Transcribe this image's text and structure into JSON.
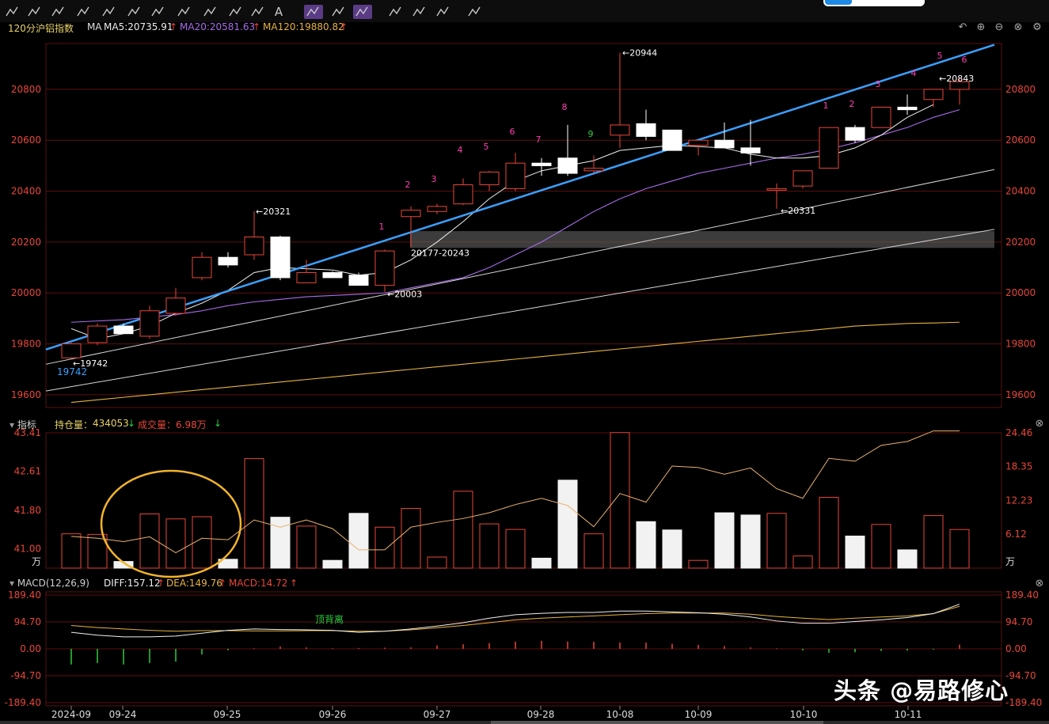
{
  "toolbar": {
    "icons": [
      "trend-line-icon",
      "polyline-icon",
      "segment-icon",
      "ray-icon",
      "price-line-icon",
      "channel-icon",
      "parallel-line-icon",
      "range-icon",
      "fib-icon",
      "fan-icon",
      "gann-icon",
      "text-icon",
      "more-icon",
      "magnet-icon",
      "layers-icon",
      "pen-icon",
      "eye-icon",
      "trash-icon",
      "grid-icon",
      "ruler-icon"
    ],
    "text_tool_label": "A",
    "more_label": "⋯"
  },
  "header": {
    "period": "120分",
    "symbol": "沪铝指数",
    "ma_label": "MA",
    "ma5": "MA5:20735.91",
    "ma20": "MA20:20581.63",
    "ma120": "MA120:19880.82",
    "arrow_up": "↑"
  },
  "colors": {
    "up": "#e8463a",
    "down": "#ffffff",
    "ma5": "#f0f0f0",
    "ma20": "#a66de8",
    "ma120": "#e6b340",
    "trend": "#3aa0ff",
    "grid": "#5c1010",
    "axis_text": "#e8463a",
    "td_count": "#ff3fb0",
    "td_count_green": "#2ecc40"
  },
  "price_axis": {
    "left_labels": [
      "20800",
      "20600",
      "20400",
      "20200",
      "20000",
      "19800",
      "19600"
    ],
    "right_labels": [
      "20800",
      "20600",
      "20400",
      "20200",
      "20000",
      "19800",
      "19600"
    ]
  },
  "annotations": {
    "high_20944": "←20944",
    "high_20843": "←20843",
    "high_20321": "←20321",
    "low_20331": "←20331",
    "low_20003": "←20003",
    "low_19742": "←19742",
    "trend_start": "19742",
    "band_label": "20177-20243"
  },
  "td_counts": [
    "1",
    "2",
    "3",
    "4",
    "5",
    "6",
    "7",
    "8",
    "9",
    "1",
    "2",
    "3",
    "4",
    "5",
    "6"
  ],
  "volume_section": {
    "title": "指标",
    "oi_label": "持仓量：",
    "oi_value": "434053",
    "vol_label": "成交量：",
    "vol_value": "6.98万",
    "down_arrow": "↓",
    "left_labels": [
      "43.41",
      "42.61",
      "41.80",
      "41.00",
      "万"
    ],
    "right_labels": [
      "24.46",
      "18.35",
      "12.23",
      "6.12",
      "万"
    ]
  },
  "macd_section": {
    "title": "MACD(12,26,9)",
    "diff": "DIFF:157.12",
    "dea": "DEA:149.76",
    "macd": "MACD:14.72",
    "arrow_up": "↑",
    "left_labels": [
      "189.40",
      "94.70",
      "0.00",
      "-94.70",
      "-189.40"
    ],
    "right_labels": [
      "189.40",
      "94.70",
      "0.00",
      "-94.70",
      "-189.40"
    ],
    "divergence_label": "顶背离"
  },
  "time_axis": [
    "2024-09",
    "09-24",
    "09-25",
    "09-26",
    "09-27",
    "09-28",
    "10-08",
    "10-09",
    "10-10",
    "10-11"
  ],
  "watermark": "头条 @易路修心",
  "chart_data": {
    "type": "candlestick",
    "candles": [
      {
        "o": 19745,
        "h": 19805,
        "l": 19742,
        "c": 19800
      },
      {
        "o": 19805,
        "h": 19880,
        "l": 19795,
        "c": 19870
      },
      {
        "o": 19870,
        "h": 19880,
        "l": 19840,
        "c": 19840
      },
      {
        "o": 19830,
        "h": 19950,
        "l": 19820,
        "c": 19930
      },
      {
        "o": 19920,
        "h": 20020,
        "l": 19910,
        "c": 19980
      },
      {
        "o": 20060,
        "h": 20160,
        "l": 20050,
        "c": 20140
      },
      {
        "o": 20140,
        "h": 20160,
        "l": 20100,
        "c": 20110
      },
      {
        "o": 20150,
        "h": 20321,
        "l": 20130,
        "c": 20220
      },
      {
        "o": 20220,
        "h": 20225,
        "l": 20050,
        "c": 20060
      },
      {
        "o": 20040,
        "h": 20130,
        "l": 20040,
        "c": 20080
      },
      {
        "o": 20080,
        "h": 20085,
        "l": 20060,
        "c": 20060
      },
      {
        "o": 20070,
        "h": 20080,
        "l": 20030,
        "c": 20030
      },
      {
        "o": 20030,
        "h": 20170,
        "l": 20003,
        "c": 20165
      },
      {
        "o": 20300,
        "h": 20340,
        "l": 20180,
        "c": 20325
      },
      {
        "o": 20320,
        "h": 20350,
        "l": 20310,
        "c": 20340
      },
      {
        "o": 20350,
        "h": 20450,
        "l": 20345,
        "c": 20425
      },
      {
        "o": 20425,
        "h": 20480,
        "l": 20400,
        "c": 20475
      },
      {
        "o": 20410,
        "h": 20550,
        "l": 20400,
        "c": 20510
      },
      {
        "o": 20510,
        "h": 20530,
        "l": 20460,
        "c": 20500
      },
      {
        "o": 20530,
        "h": 20660,
        "l": 20460,
        "c": 20470
      },
      {
        "o": 20480,
        "h": 20540,
        "l": 20470,
        "c": 20490
      },
      {
        "o": 20620,
        "h": 20944,
        "l": 20570,
        "c": 20660
      },
      {
        "o": 20665,
        "h": 20720,
        "l": 20600,
        "c": 20615
      },
      {
        "o": 20640,
        "h": 20640,
        "l": 20560,
        "c": 20560
      },
      {
        "o": 20580,
        "h": 20600,
        "l": 20540,
        "c": 20600
      },
      {
        "o": 20600,
        "h": 20670,
        "l": 20570,
        "c": 20570
      },
      {
        "o": 20570,
        "h": 20680,
        "l": 20500,
        "c": 20550
      },
      {
        "o": 20410,
        "h": 20430,
        "l": 20331,
        "c": 20410
      },
      {
        "o": 20420,
        "h": 20480,
        "l": 20410,
        "c": 20480
      },
      {
        "o": 20490,
        "h": 20650,
        "l": 20490,
        "c": 20650
      },
      {
        "o": 20650,
        "h": 20660,
        "l": 20590,
        "c": 20600
      },
      {
        "o": 20650,
        "h": 20730,
        "l": 20650,
        "c": 20730
      },
      {
        "o": 20730,
        "h": 20780,
        "l": 20700,
        "c": 20720
      },
      {
        "o": 20760,
        "h": 20800,
        "l": 20730,
        "c": 20800
      },
      {
        "o": 20800,
        "h": 20843,
        "l": 20740,
        "c": 20830
      }
    ],
    "ma5": [
      19860,
      19820,
      19840,
      19870,
      19920,
      19960,
      20010,
      20080,
      20100,
      20095,
      20090,
      20070,
      20080,
      20130,
      20200,
      20280,
      20370,
      20440,
      20480,
      20500,
      20520,
      20560,
      20570,
      20580,
      20575,
      20570,
      20545,
      20530,
      20530,
      20540,
      20570,
      20620,
      20690,
      20740
    ],
    "ma20": [
      19885,
      19890,
      19895,
      19905,
      19915,
      19930,
      19950,
      19965,
      19975,
      19985,
      19990,
      19995,
      20000,
      20020,
      20040,
      20060,
      20100,
      20150,
      20200,
      20260,
      20320,
      20370,
      20410,
      20440,
      20470,
      20490,
      20510,
      20530,
      20545,
      20565,
      20590,
      20620,
      20650,
      20690,
      20720
    ],
    "ma120": [
      19570,
      19580,
      19590,
      19600,
      19610,
      19620,
      19630,
      19640,
      19650,
      19660,
      19670,
      19680,
      19690,
      19700,
      19710,
      19720,
      19730,
      19740,
      19750,
      19760,
      19770,
      19780,
      19790,
      19800,
      19810,
      19820,
      19830,
      19840,
      19850,
      19860,
      19870,
      19875,
      19880,
      19882,
      19885
    ],
    "volume_wan": [
      6.2,
      6.1,
      1.2,
      9.8,
      8.9,
      9.3,
      1.6,
      19.8,
      9.2,
      7.6,
      1.4,
      9.9,
      7.4,
      10.8,
      2.0,
      13.9,
      8.0,
      7.0,
      1.8,
      15.9,
      6.2,
      24.5,
      8.4,
      6.9,
      1.4,
      10.0,
      9.6,
      9.9,
      2.2,
      12.8,
      5.8,
      7.9,
      3.3,
      9.5,
      6.98
    ],
    "open_interest": [
      41.26,
      41.22,
      41.15,
      41.25,
      40.92,
      41.22,
      41.19,
      41.6,
      41.45,
      41.6,
      41.42,
      40.98,
      40.98,
      41.45,
      41.55,
      41.63,
      41.75,
      41.92,
      42.05,
      41.9,
      41.46,
      42.15,
      41.97,
      42.72,
      42.69,
      42.55,
      42.68,
      42.25,
      42.05,
      42.88,
      42.82,
      43.15,
      43.23,
      43.45,
      43.45
    ],
    "macd_bars": [
      -55,
      -50,
      -55,
      -50,
      -45,
      -20,
      -5,
      2,
      8,
      5,
      2,
      3,
      4,
      5,
      12,
      16,
      20,
      25,
      28,
      26,
      25,
      22,
      22,
      18,
      14,
      10,
      5,
      2,
      -6,
      -14,
      -12,
      -8,
      -6,
      -3,
      14.72
    ],
    "diff": [
      58,
      48,
      42,
      42,
      45,
      55,
      65,
      70,
      68,
      67,
      65,
      58,
      62,
      70,
      80,
      92,
      108,
      120,
      125,
      128,
      128,
      133,
      133,
      130,
      127,
      122,
      112,
      98,
      90,
      90,
      96,
      102,
      110,
      124,
      157.12
    ],
    "dea": [
      82,
      75,
      70,
      65,
      62,
      64,
      64,
      63,
      63,
      64,
      64,
      62,
      62,
      67,
      74,
      82,
      92,
      102,
      108,
      112,
      116,
      120,
      124,
      126,
      126,
      126,
      122,
      114,
      108,
      103,
      108,
      112,
      116,
      124,
      149.76
    ],
    "price_ylim": [
      19550,
      20980
    ],
    "volume_ylim": [
      0,
      24.46
    ],
    "oi_ylim": [
      40.6,
      43.41
    ],
    "macd_ylim": [
      -189.4,
      189.4
    ]
  }
}
